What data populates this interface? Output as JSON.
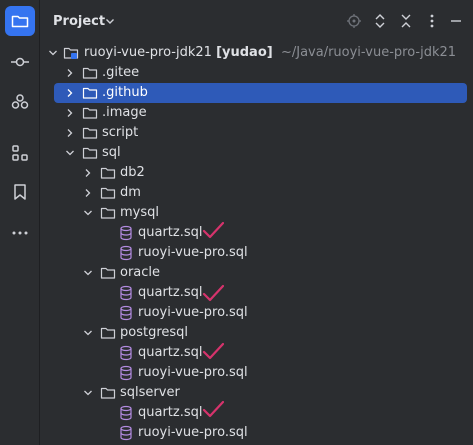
{
  "panel": {
    "title": "Project"
  },
  "colors": {
    "accent": "#3574f0",
    "selection": "#2e5ab8",
    "check": "#d6336c",
    "sql_icon": "#b38be0",
    "folder_outline": "#ced0d6"
  },
  "strip_icons": [
    "project-icon",
    "commit-icon",
    "plugins-icon",
    "structure-icon",
    "bookmarks-icon",
    "more-icon"
  ],
  "tree": {
    "root": {
      "name": "ruoyi-vue-pro-jdk21",
      "module": "[yudao]",
      "path": "~/Java/ruoyi-vue-pro-jdk21"
    },
    "items": [
      {
        "label": ".gitee"
      },
      {
        "label": ".github"
      },
      {
        "label": ".image"
      },
      {
        "label": "script"
      },
      {
        "label": "sql"
      },
      {
        "label": "db2"
      },
      {
        "label": "dm"
      },
      {
        "label": "mysql"
      },
      {
        "label": "quartz.sql"
      },
      {
        "label": "ruoyi-vue-pro.sql"
      },
      {
        "label": "oracle"
      },
      {
        "label": "quartz.sql"
      },
      {
        "label": "ruoyi-vue-pro.sql"
      },
      {
        "label": "postgresql"
      },
      {
        "label": "quartz.sql"
      },
      {
        "label": "ruoyi-vue-pro.sql"
      },
      {
        "label": "sqlserver"
      },
      {
        "label": "quartz.sql"
      },
      {
        "label": "ruoyi-vue-pro.sql"
      }
    ]
  }
}
